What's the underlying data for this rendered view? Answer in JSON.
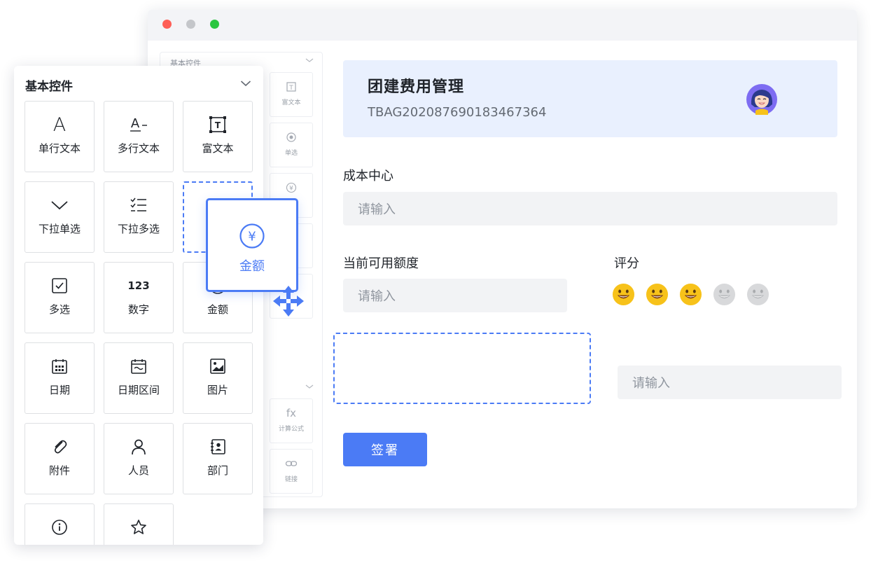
{
  "window": {
    "bg_palette": {
      "title": "基本控件",
      "tiles": [
        {
          "label": "富文本",
          "icon": "rich-text-icon"
        },
        {
          "label": "单选",
          "icon": "radio-icon"
        },
        {
          "label": "",
          "icon": "yen-icon"
        },
        {
          "label": "计算公式",
          "icon": "formula-icon",
          "glyph": "fx"
        },
        {
          "label": "链接",
          "icon": "link-icon"
        }
      ]
    },
    "header": {
      "title": "团建费用管理",
      "code": "TBAG202087690183467364"
    },
    "form": {
      "cost_center_label": "成本中心",
      "cost_center_placeholder": "请输入",
      "quota_label": "当前可用额度",
      "quota_placeholder": "请输入",
      "rating_label": "评分",
      "rating": {
        "value": 3,
        "max": 5
      },
      "extra_placeholder": "请输入",
      "sign_button": "签署"
    }
  },
  "palette": {
    "title": "基本控件",
    "tiles": [
      {
        "label": "单行文本",
        "icon": "single-line-text-icon",
        "glyph": "A"
      },
      {
        "label": "多行文本",
        "icon": "multi-line-text-icon",
        "glyph": "A"
      },
      {
        "label": "富文本",
        "icon": "rich-text-icon",
        "glyph": "T"
      },
      {
        "label": "下拉单选",
        "icon": "dropdown-single-icon"
      },
      {
        "label": "下拉多选",
        "icon": "dropdown-multi-icon"
      },
      {
        "label": "",
        "icon": "drop-placeholder"
      },
      {
        "label": "多选",
        "icon": "checkbox-icon"
      },
      {
        "label": "数字",
        "icon": "number-icon",
        "glyph": "123"
      },
      {
        "label": "金额",
        "icon": "amount-icon"
      },
      {
        "label": "日期",
        "icon": "date-icon"
      },
      {
        "label": "日期区间",
        "icon": "date-range-icon"
      },
      {
        "label": "图片",
        "icon": "image-icon"
      },
      {
        "label": "附件",
        "icon": "attachment-icon"
      },
      {
        "label": "人员",
        "icon": "person-icon"
      },
      {
        "label": "部门",
        "icon": "department-icon"
      },
      {
        "label": "",
        "icon": "info-icon"
      },
      {
        "label": "",
        "icon": "star-icon"
      }
    ]
  },
  "drag_tile": {
    "label": "金额",
    "icon": "yen-icon",
    "glyph": "¥"
  },
  "colors": {
    "accent": "#4b7bf5",
    "header_bg": "#e9f0fe",
    "input_bg": "#f2f3f5",
    "emoji_active": "#f7c21a",
    "emoji_inactive": "#d8d9db"
  }
}
